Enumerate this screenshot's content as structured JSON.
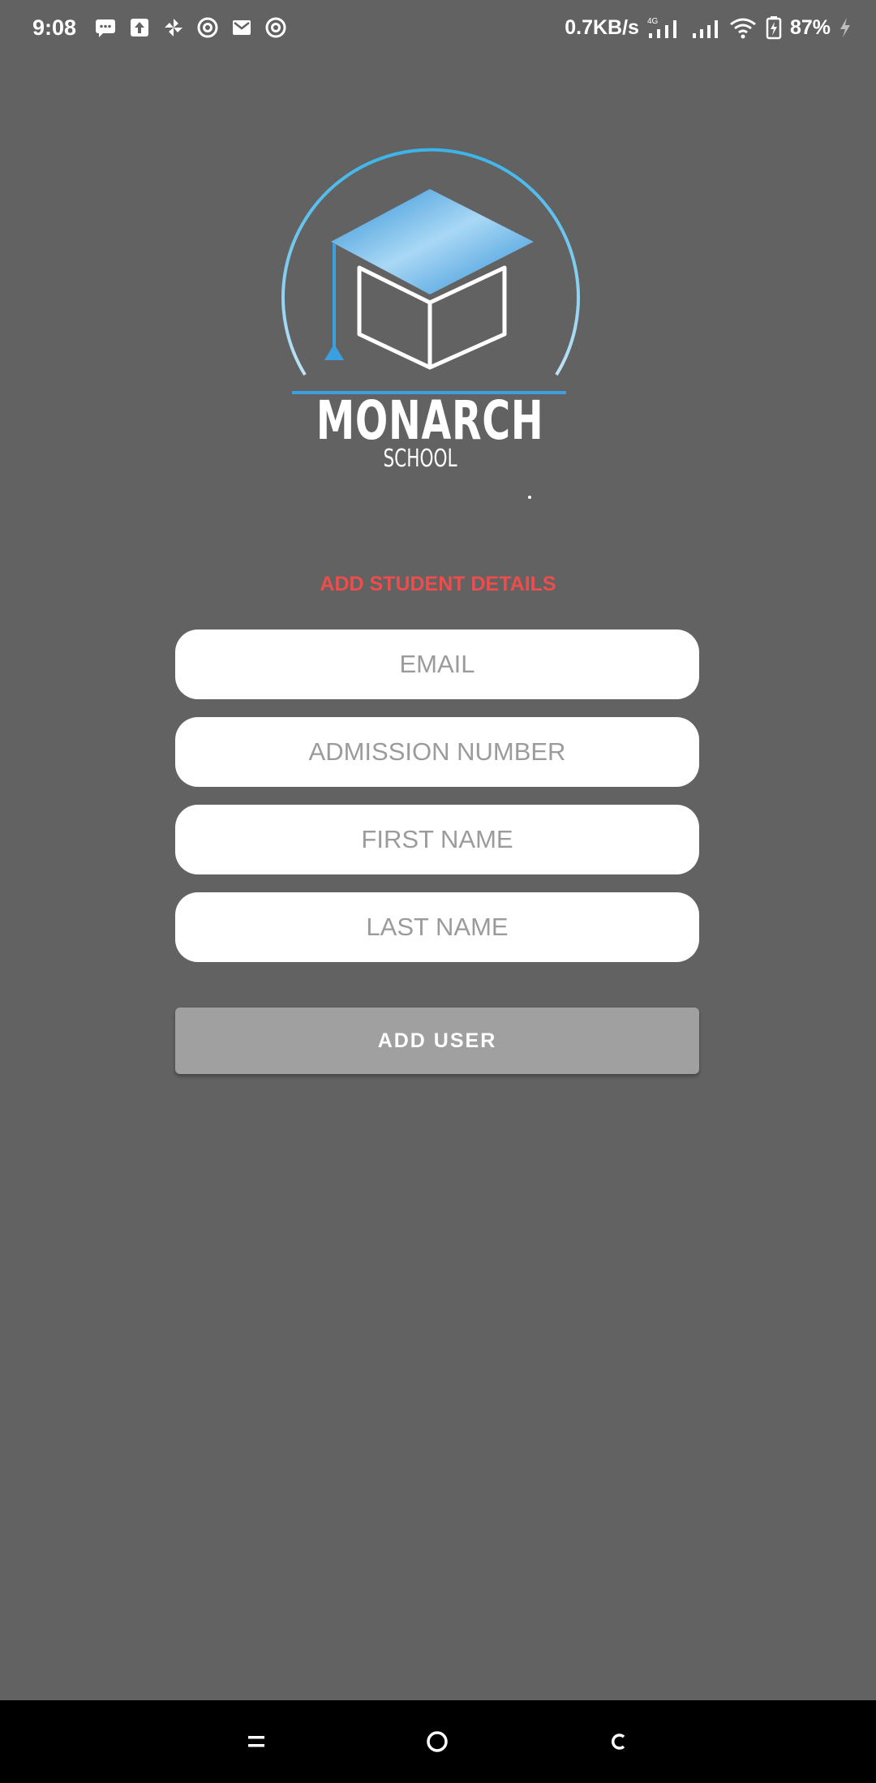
{
  "status_bar": {
    "time": "9:08",
    "net_speed": "0.7KB/s",
    "network_type": "4G",
    "battery": "87%",
    "left_icons": [
      "message-icon",
      "upload-icon",
      "pinwheel-icon",
      "at-icon",
      "mail-icon",
      "at-icon"
    ],
    "right_icons": [
      "signal-4g-icon",
      "signal-icon",
      "wifi-icon",
      "battery-charging-icon",
      "bolt-icon"
    ]
  },
  "logo": {
    "name": "MONARCH",
    "subtitle": "SCHOOL",
    "accent_color": "#3aa0e0"
  },
  "form": {
    "title": "ADD STUDENT DETAILS",
    "title_color": "#ef4c4c",
    "email_placeholder": "EMAIL",
    "admission_placeholder": "ADMISSION NUMBER",
    "first_name_placeholder": "FIRST NAME",
    "last_name_placeholder": "LAST NAME",
    "submit_label": "ADD USER"
  },
  "nav_bar": {
    "icons": [
      "menu-icon",
      "home-icon",
      "back-icon"
    ]
  }
}
